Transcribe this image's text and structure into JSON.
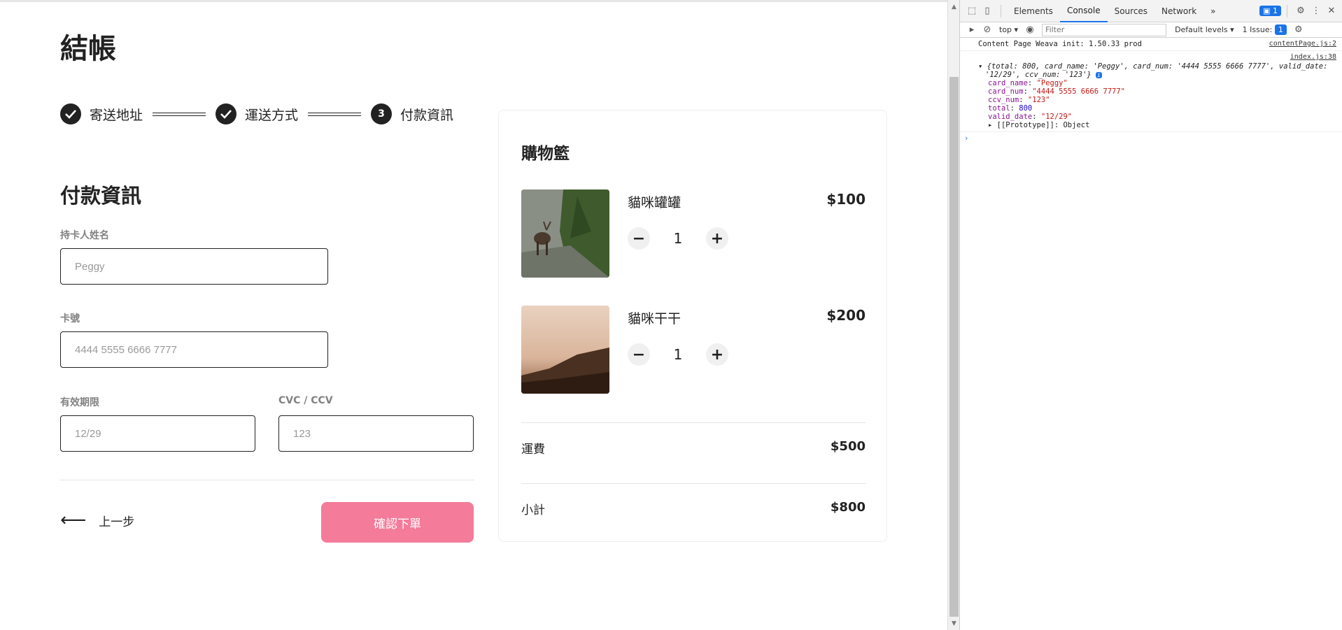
{
  "page": {
    "title": "結帳",
    "steps": [
      {
        "label": "寄送地址",
        "state": "done",
        "icon": "check-icon"
      },
      {
        "label": "運送方式",
        "state": "done",
        "icon": "check-icon"
      },
      {
        "label": "付款資訊",
        "state": "active",
        "number": "3"
      }
    ],
    "section_title": "付款資訊",
    "fields": {
      "card_name": {
        "label": "持卡人姓名",
        "placeholder": "Peggy"
      },
      "card_num": {
        "label": "卡號",
        "placeholder": "4444 5555 6666 7777"
      },
      "valid_date": {
        "label": "有效期限",
        "placeholder": "12/29"
      },
      "ccv": {
        "label": "CVC / CCV",
        "placeholder": "123"
      }
    },
    "back_label": "上一步",
    "confirm_label": "確認下單"
  },
  "cart": {
    "title": "購物籃",
    "items": [
      {
        "name": "貓咪罐罐",
        "price": "$100",
        "qty": "1"
      },
      {
        "name": "貓咪干干",
        "price": "$200",
        "qty": "1"
      }
    ],
    "shipping_label": "運費",
    "shipping_value": "$500",
    "subtotal_label": "小計",
    "subtotal_value": "$800"
  },
  "devtools": {
    "tabs": [
      "Elements",
      "Console",
      "Sources",
      "Network"
    ],
    "active_tab": "Console",
    "more": "»",
    "messages_badge": "1",
    "context": "top",
    "filter_placeholder": "Filter",
    "levels": "Default levels",
    "issues": "1 Issue:",
    "issues_count": "1",
    "log1_text": "Content Page Weava init: 1.50.33 prod",
    "log1_src": "contentPage.js:2",
    "log2_src": "index.js:38",
    "obj_summary_1": "{total: 800, card_name: 'Peggy', card_num: '4444 5555 6666 7777', valid_date:",
    "obj_summary_2": "'12/29', ccv_num: '123'}",
    "props": [
      {
        "k": "card_name",
        "v": "\"Peggy\"",
        "type": "str"
      },
      {
        "k": "card_num",
        "v": "\"4444 5555 6666 7777\"",
        "type": "str"
      },
      {
        "k": "ccv_num",
        "v": "\"123\"",
        "type": "str"
      },
      {
        "k": "total",
        "v": "800",
        "type": "num"
      },
      {
        "k": "valid_date",
        "v": "\"12/29\"",
        "type": "str"
      }
    ],
    "prototype": "[[Prototype]]: Object",
    "prompt": "›"
  }
}
